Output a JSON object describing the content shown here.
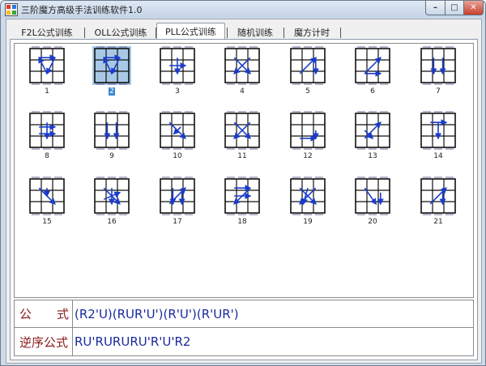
{
  "window": {
    "title": "三阶魔方高级手法训练软件1.0",
    "controls": {
      "minimize": "–",
      "maximize": "□",
      "close": "✕"
    }
  },
  "tabs": [
    {
      "label": "F2L公式训练",
      "active": false
    },
    {
      "label": "OLL公式训练",
      "active": false
    },
    {
      "label": "PLL公式训练",
      "active": true
    },
    {
      "label": "随机训练",
      "active": false
    },
    {
      "label": "魔方计时",
      "active": false
    }
  ],
  "selected_case": "2",
  "cases": [
    {
      "label": "1"
    },
    {
      "label": "2"
    },
    {
      "label": "3"
    },
    {
      "label": "4"
    },
    {
      "label": "5"
    },
    {
      "label": "6"
    },
    {
      "label": "7"
    },
    {
      "label": "8"
    },
    {
      "label": "9"
    },
    {
      "label": "10"
    },
    {
      "label": "11"
    },
    {
      "label": "12"
    },
    {
      "label": "13"
    },
    {
      "label": "14"
    },
    {
      "label": "15"
    },
    {
      "label": "16"
    },
    {
      "label": "17"
    },
    {
      "label": "18"
    },
    {
      "label": "19"
    },
    {
      "label": "20"
    },
    {
      "label": "21"
    }
  ],
  "formula": {
    "label_left": "公",
    "label_right": "式",
    "value": "(R2'U)(RUR'U')(R'U')(R'UR')"
  },
  "inverse": {
    "label": "逆序公式",
    "value": "RU'RURURU'R'U'R2"
  },
  "colors": {
    "arrow": "#1a3ccc",
    "selected_bg": "#a8c9e6",
    "label_red": "#8b1a1a",
    "formula_blue": "#1a2aa0"
  }
}
